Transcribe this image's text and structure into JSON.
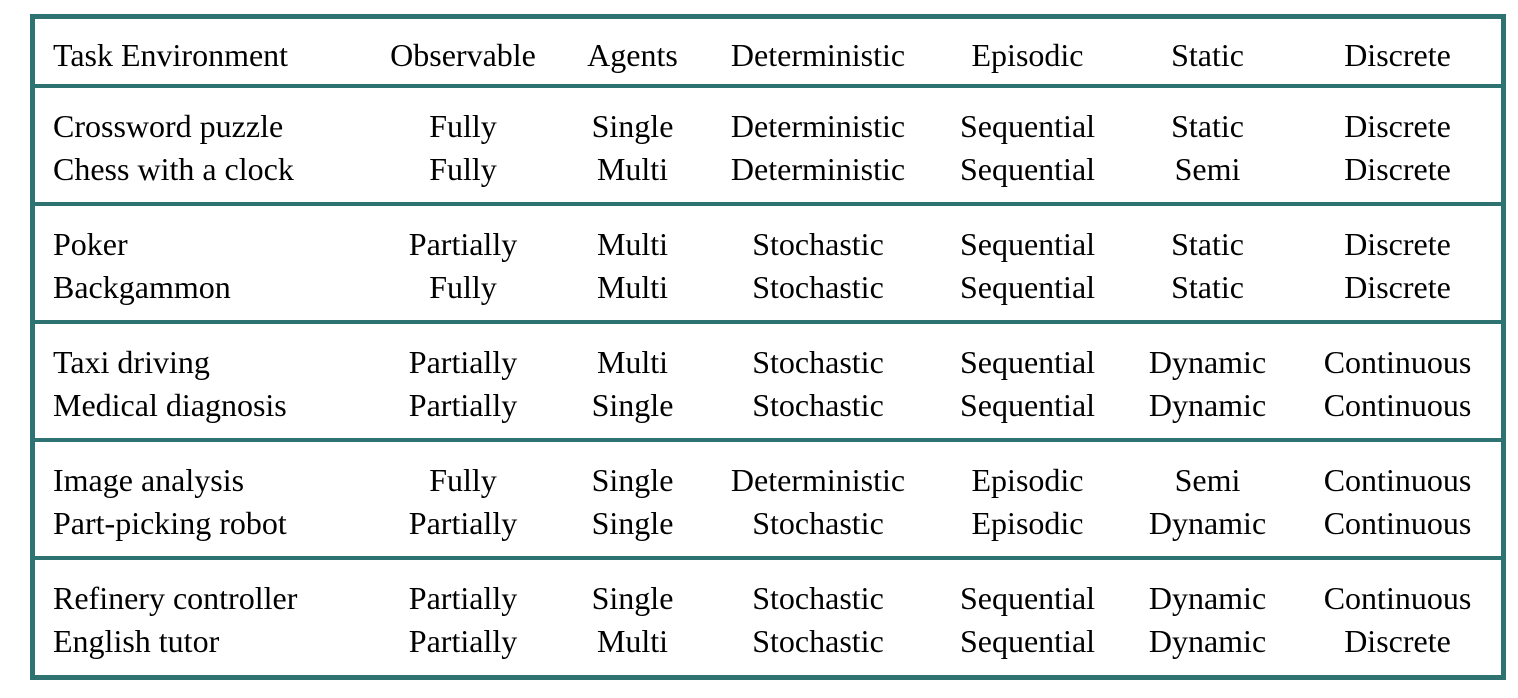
{
  "table": {
    "columns": [
      "Task Environment",
      "Observable",
      "Agents",
      "Deterministic",
      "Episodic",
      "Static",
      "Discrete"
    ],
    "groups": [
      {
        "rows": [
          [
            "Crossword puzzle",
            "Fully",
            "Single",
            "Deterministic",
            "Sequential",
            "Static",
            "Discrete"
          ],
          [
            "Chess with a clock",
            "Fully",
            "Multi",
            "Deterministic",
            "Sequential",
            "Semi",
            "Discrete"
          ]
        ]
      },
      {
        "rows": [
          [
            "Poker",
            "Partially",
            "Multi",
            "Stochastic",
            "Sequential",
            "Static",
            "Discrete"
          ],
          [
            "Backgammon",
            "Fully",
            "Multi",
            "Stochastic",
            "Sequential",
            "Static",
            "Discrete"
          ]
        ]
      },
      {
        "rows": [
          [
            "Taxi driving",
            "Partially",
            "Multi",
            "Stochastic",
            "Sequential",
            "Dynamic",
            "Continuous"
          ],
          [
            "Medical diagnosis",
            "Partially",
            "Single",
            "Stochastic",
            "Sequential",
            "Dynamic",
            "Continuous"
          ]
        ]
      },
      {
        "rows": [
          [
            "Image analysis",
            "Fully",
            "Single",
            "Deterministic",
            "Episodic",
            "Semi",
            "Continuous"
          ],
          [
            "Part-picking robot",
            "Partially",
            "Single",
            "Stochastic",
            "Episodic",
            "Dynamic",
            "Continuous"
          ]
        ]
      },
      {
        "rows": [
          [
            "Refinery controller",
            "Partially",
            "Single",
            "Stochastic",
            "Sequential",
            "Dynamic",
            "Continuous"
          ],
          [
            "English tutor",
            "Partially",
            "Multi",
            "Stochastic",
            "Sequential",
            "Dynamic",
            "Discrete"
          ]
        ]
      }
    ]
  },
  "colors": {
    "border": "#2e7272",
    "text": "#000000",
    "background": "#ffffff"
  }
}
